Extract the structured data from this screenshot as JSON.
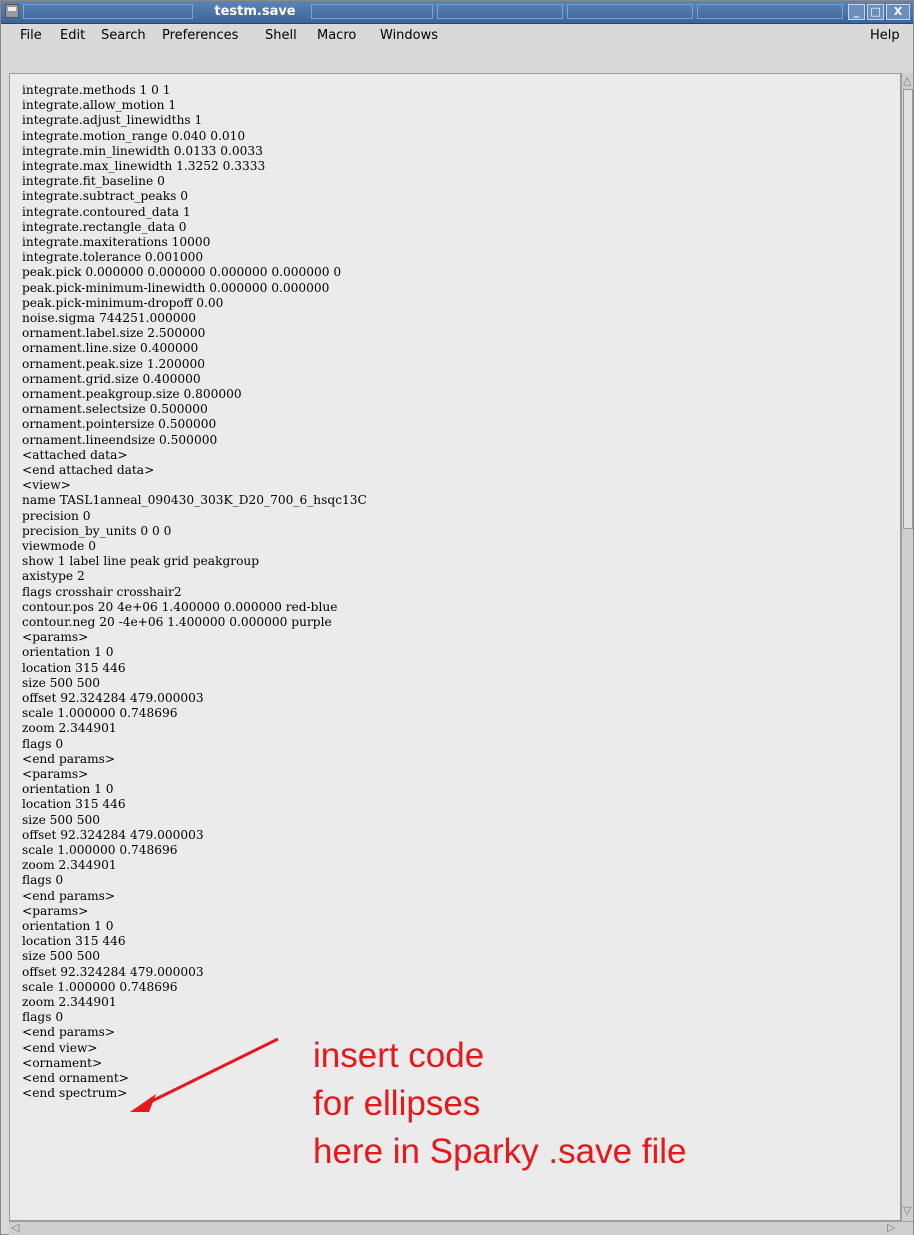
{
  "window": {
    "title": "testm.save"
  },
  "menu": {
    "items": [
      "File",
      "Edit",
      "Search",
      "Preferences",
      "Shell",
      "Macro",
      "Windows"
    ],
    "help": "Help"
  },
  "file_lines": [
    "integrate.methods 1 0 1",
    "integrate.allow_motion 1",
    "integrate.adjust_linewidths 1",
    "integrate.motion_range 0.040 0.010",
    "integrate.min_linewidth 0.0133 0.0033",
    "integrate.max_linewidth 1.3252 0.3333",
    "integrate.fit_baseline 0",
    "integrate.subtract_peaks 0",
    "integrate.contoured_data 1",
    "integrate.rectangle_data 0",
    "integrate.maxiterations 10000",
    "integrate.tolerance 0.001000",
    "peak.pick 0.000000 0.000000 0.000000 0.000000 0",
    "peak.pick-minimum-linewidth 0.000000 0.000000",
    "peak.pick-minimum-dropoff 0.00",
    "noise.sigma 744251.000000",
    "ornament.label.size 2.500000",
    "ornament.line.size 0.400000",
    "ornament.peak.size 1.200000",
    "ornament.grid.size 0.400000",
    "ornament.peakgroup.size 0.800000",
    "ornament.selectsize 0.500000",
    "ornament.pointersize 0.500000",
    "ornament.lineendsize 0.500000",
    "<attached data>",
    "<end attached data>",
    "<view>",
    "name TASL1anneal_090430_303K_D20_700_6_hsqc13C",
    "precision 0",
    "precision_by_units 0 0 0",
    "viewmode 0",
    "show 1 label line peak grid peakgroup",
    "axistype 2",
    "flags crosshair crosshair2",
    "contour.pos 20 4e+06 1.400000 0.000000 red-blue",
    "contour.neg 20 -4e+06 1.400000 0.000000 purple",
    "<params>",
    "orientation 1 0",
    "location 315 446",
    "size 500 500",
    "offset 92.324284 479.000003",
    "scale 1.000000 0.748696",
    "zoom 2.344901",
    "flags 0",
    "<end params>",
    "<params>",
    "orientation 1 0",
    "location 315 446",
    "size 500 500",
    "offset 92.324284 479.000003",
    "scale 1.000000 0.748696",
    "zoom 2.344901",
    "flags 0",
    "<end params>",
    "<params>",
    "orientation 1 0",
    "location 315 446",
    "size 500 500",
    "offset 92.324284 479.000003",
    "scale 1.000000 0.748696",
    "zoom 2.344901",
    "flags 0",
    "<end params>",
    "<end view>",
    "<ornament>",
    "<end ornament>",
    "<end spectrum>"
  ],
  "annotation": {
    "text": "insert code\nfor ellipses\nhere in Sparky .save file",
    "color": "#e8171c"
  },
  "colors": {
    "titlebar": "#4a72a8",
    "editor_bg": "#ebebeb",
    "annotation_red": "#e8171c"
  }
}
